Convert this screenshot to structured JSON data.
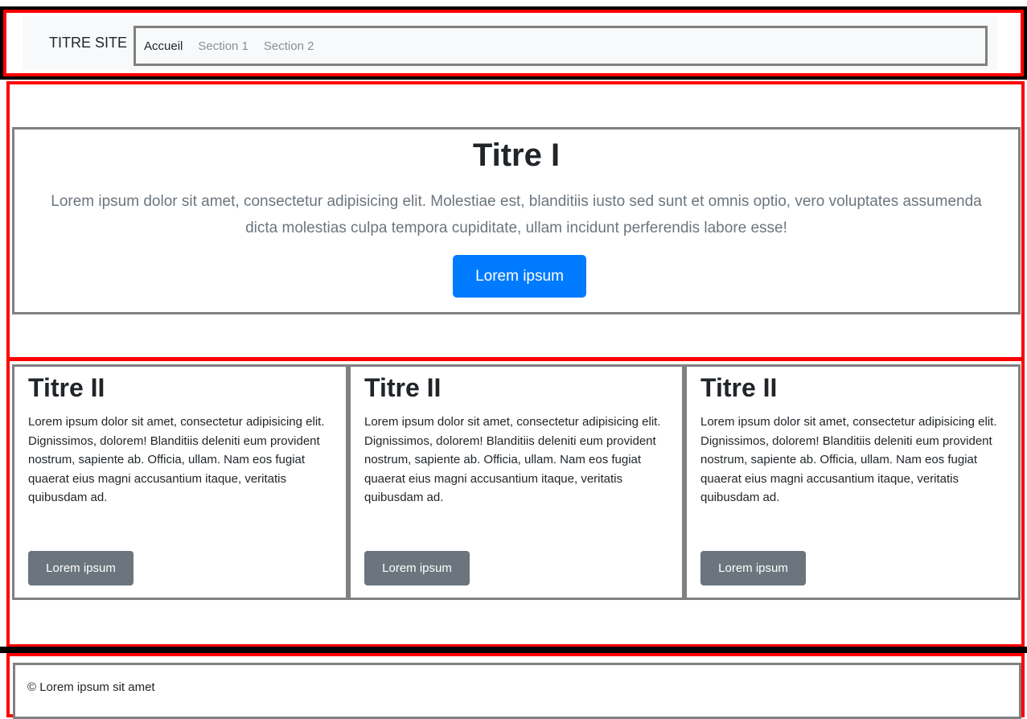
{
  "header": {
    "brand": "TITRE SITE",
    "nav": [
      {
        "label": "Accueil",
        "active": true
      },
      {
        "label": "Section 1",
        "active": false
      },
      {
        "label": "Section 2",
        "active": false
      }
    ]
  },
  "hero": {
    "title": "Titre I",
    "lead": "Lorem ipsum dolor sit amet, consectetur adipisicing elit. Molestiae est, blanditiis iusto sed sunt et omnis optio, vero voluptates assumenda dicta molestias culpa tempora cupiditate, ullam incidunt perferendis labore esse!",
    "button": "Lorem ipsum"
  },
  "cards": [
    {
      "title": "Titre II",
      "text": "Lorem ipsum dolor sit amet, consectetur adipisicing elit. Dignissimos, dolorem! Blanditiis deleniti eum provident nostrum, sapiente ab. Officia, ullam. Nam eos fugiat quaerat eius magni accusantium itaque, veritatis quibusdam ad.",
      "button": "Lorem ipsum"
    },
    {
      "title": "Titre II",
      "text": "Lorem ipsum dolor sit amet, consectetur adipisicing elit. Dignissimos, dolorem! Blanditiis deleniti eum provident nostrum, sapiente ab. Officia, ullam. Nam eos fugiat quaerat eius magni accusantium itaque, veritatis quibusdam ad.",
      "button": "Lorem ipsum"
    },
    {
      "title": "Titre II",
      "text": "Lorem ipsum dolor sit amet, consectetur adipisicing elit. Dignissimos, dolorem! Blanditiis deleniti eum provident nostrum, sapiente ab. Officia, ullam. Nam eos fugiat quaerat eius magni accusantium itaque, veritatis quibusdam ad.",
      "button": "Lorem ipsum"
    }
  ],
  "footer": {
    "text": "© Lorem ipsum sit amet"
  },
  "colors": {
    "primary": "#007bff",
    "secondary": "#6c757d",
    "debug_outline_red": "#ff0000",
    "debug_outline_black": "#000000",
    "box_border_gray": "#808080",
    "navbar_bg": "#f8f9fa"
  }
}
